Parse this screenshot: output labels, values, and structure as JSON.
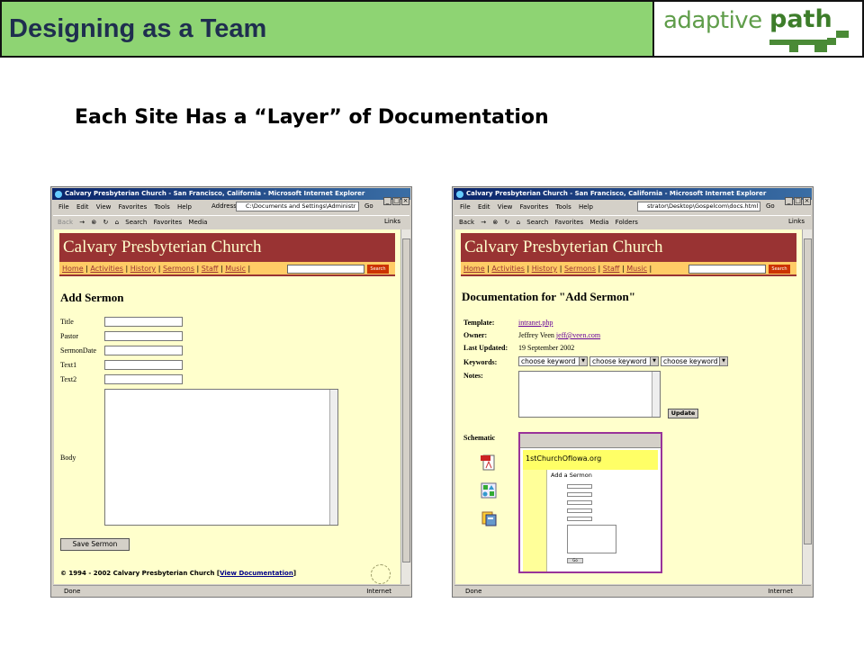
{
  "slide": {
    "title": "Designing as a Team",
    "subtitle": "Each Site Has a “Layer” of Documentation",
    "logo_left": "adaptive",
    "logo_right": "path"
  },
  "browser_common": {
    "window_title": "Calvary Presbyterian Church - San Francisco, California - Microsoft Internet Explorer",
    "menu": [
      "File",
      "Edit",
      "View",
      "Favorites",
      "Tools",
      "Help"
    ],
    "toolbar": [
      "Back",
      "Search",
      "Favorites",
      "Media",
      "Folders"
    ],
    "address_label": "Address",
    "go_label": "Go",
    "links_label": "Links",
    "status_done": "Done",
    "status_zone": "Internet",
    "site_title": "Calvary Presbyterian Church",
    "nav": [
      "Home",
      "Activities",
      "History",
      "Sermons",
      "Staff",
      "Music"
    ],
    "search_btn": "Search"
  },
  "left_browser": {
    "address": "C:\\Documents and Settings\\Administr",
    "heading": "Add Sermon",
    "fields": [
      "Title",
      "Pastor",
      "SermonDate",
      "Text1",
      "Text2"
    ],
    "body_label": "Body",
    "save_button": "Save Sermon",
    "footer_prefix": "© 1994 - 2002 Calvary Presbyterian Church [",
    "footer_link": "View Documentation",
    "footer_suffix": "]"
  },
  "right_browser": {
    "address": "strator\\Desktop\\Gospelcom\\docs.html",
    "heading": "Documentation for \"Add Sermon\"",
    "template_label": "Template:",
    "template_value": "intranet.php",
    "owner_label": "Owner:",
    "owner_name": "Jeffrey Veen",
    "owner_email": "jeff@veen.com",
    "updated_label": "Last Updated:",
    "updated_value": "19 September 2002",
    "keywords_label": "Keywords:",
    "keyword_options": [
      "choose keyword",
      "choose keyword",
      "choose keyword"
    ],
    "notes_label": "Notes:",
    "update_button": "Update",
    "schematic_label": "Schematic",
    "schematic": {
      "site_name": "1stChurchOfIowa.org",
      "page_heading": "Add a Sermon",
      "button": "Go"
    }
  }
}
